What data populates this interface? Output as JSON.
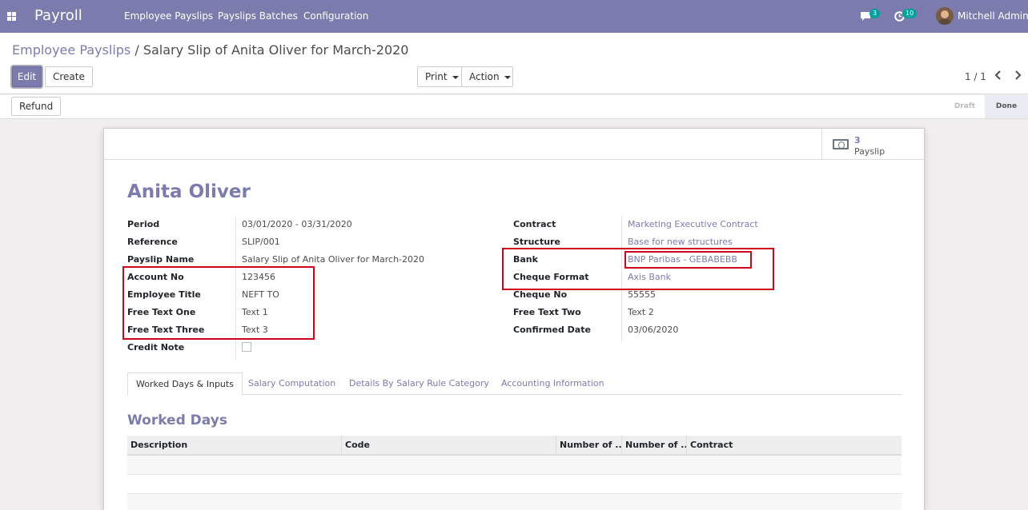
{
  "nav": {
    "app_name": "Payroll",
    "menu": [
      "Employee Payslips",
      "Payslips Batches",
      "Configuration"
    ],
    "messages_count": "3",
    "activities_count": "10",
    "user_name": "Mitchell Admin"
  },
  "breadcrumb": {
    "parent": "Employee Payslips",
    "separator": "/",
    "current": "Salary Slip of Anita Oliver for March-2020"
  },
  "toolbar": {
    "edit_label": "Edit",
    "create_label": "Create",
    "print_label": "Print",
    "action_label": "Action",
    "pager": "1 / 1"
  },
  "statusbar": {
    "refund_label": "Refund",
    "stages": [
      "Draft",
      "Done"
    ],
    "active_stage": "Done"
  },
  "stat_button": {
    "value": "3",
    "label": "Payslip"
  },
  "employee_name": "Anita Oliver",
  "left_fields": [
    {
      "label": "Period",
      "value": "03/01/2020 - 03/31/2020"
    },
    {
      "label": "Reference",
      "value": "SLIP/001"
    },
    {
      "label": "Payslip Name",
      "value": "Salary Slip of Anita Oliver for March-2020"
    },
    {
      "label": "Account No",
      "value": "123456"
    },
    {
      "label": "Employee Title",
      "value": "NEFT TO"
    },
    {
      "label": "Free Text One",
      "value": "Text 1"
    },
    {
      "label": "Free Text Three",
      "value": "Text 3"
    },
    {
      "label": "Credit Note",
      "value": ""
    }
  ],
  "right_fields": [
    {
      "label": "Contract",
      "value": "Marketing Executive Contract"
    },
    {
      "label": "Structure",
      "value": "Base for new structures"
    },
    {
      "label": "Bank",
      "value": "BNP Paribas - GEBABEBB"
    },
    {
      "label": "Cheque Format",
      "value": "Axis Bank"
    },
    {
      "label": "Cheque No",
      "value": "55555"
    },
    {
      "label": "Free Text Two",
      "value": "Text 2"
    },
    {
      "label": "Confirmed Date",
      "value": "03/06/2020"
    }
  ],
  "tabs": [
    "Worked Days & Inputs",
    "Salary Computation",
    "Details By Salary Rule Category",
    "Accounting Information"
  ],
  "worked_days": {
    "title": "Worked Days",
    "columns": [
      "Description",
      "Code",
      "Number of ...",
      "Number of ...",
      "Contract"
    ]
  },
  "colors": {
    "brand": "#7c7bad",
    "highlight": "#d0021b",
    "badge": "#00a09d"
  }
}
